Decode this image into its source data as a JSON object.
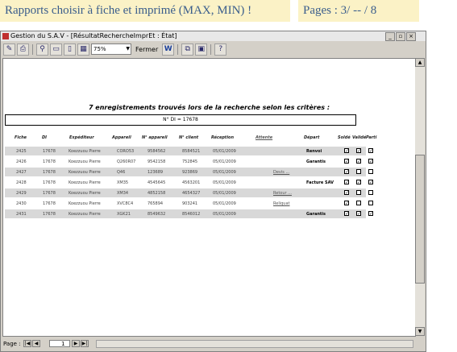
{
  "banner": {
    "title": "Rapports choisir à fiche et imprimé (MAX, MIN) !",
    "pages": "Pages : 3/ -- / 8"
  },
  "window": {
    "title": "Gestion du S.A.V - [RésultatRechercheImprEt : État]",
    "zoom": "75%",
    "close_label": "Fermer",
    "icons": [
      "view-icon",
      "print-icon",
      "zoom-icon",
      "one-page-icon",
      "two-pages-icon",
      "multiple-pages-icon",
      "word-icon",
      "database-window-icon",
      "new-object-icon",
      "help-icon"
    ]
  },
  "report": {
    "title": "7 enregistrements trouvés lors de la recherche selon les critères :",
    "criteria": "N° DI = 17678",
    "columns": [
      "Fiche",
      "DI",
      "Expéditeur",
      "Appareil",
      "N° appareil",
      "N° client",
      "Réception",
      "Attente",
      "Départ",
      "Soldé",
      "Validé",
      "Parti"
    ],
    "rows": [
      {
        "fiche": "2425",
        "di": "17678",
        "expediteur": "Koezzuou Pierre",
        "appareil": "CORO53",
        "n_appareil": "9584562",
        "n_client": "8584521",
        "reception": "05/01/2009",
        "attente": "",
        "depart": "Renvoi",
        "solde": true,
        "valide": true,
        "parti": true
      },
      {
        "fiche": "2426",
        "di": "17678",
        "expediteur": "Koezzuou Pierre",
        "appareil": "Q260R07",
        "n_appareil": "9542158",
        "n_client": "752845",
        "reception": "05/01/2009",
        "attente": "",
        "depart": "Garantis",
        "solde": true,
        "valide": true,
        "parti": true
      },
      {
        "fiche": "2427",
        "di": "17678",
        "expediteur": "Koezzuou Pierre",
        "appareil": "Q46",
        "n_appareil": "123689",
        "n_client": "923869",
        "reception": "05/01/2009",
        "attente": "Devis ...",
        "depart": "",
        "solde": true,
        "valide": false,
        "parti": false
      },
      {
        "fiche": "2428",
        "di": "17678",
        "expediteur": "Koezzuou Pierre",
        "appareil": "XM35",
        "n_appareil": "4545645",
        "n_client": "4563201",
        "reception": "05/01/2009",
        "attente": "",
        "depart": "Facture SAV",
        "solde": true,
        "valide": true,
        "parti": true
      },
      {
        "fiche": "2429",
        "di": "17678",
        "expediteur": "Koezzuou Pierre",
        "appareil": "XM34",
        "n_appareil": "4852158",
        "n_client": "4654327",
        "reception": "05/01/2009",
        "attente": "Retour ...",
        "depart": "",
        "solde": true,
        "valide": false,
        "parti": false
      },
      {
        "fiche": "2430",
        "di": "17678",
        "expediteur": "Koezzuou Pierre",
        "appareil": "XVC8C4",
        "n_appareil": "765894",
        "n_client": "903241",
        "reception": "05/01/2009",
        "attente": "Reliquat",
        "depart": "",
        "solde": true,
        "valide": false,
        "parti": false
      },
      {
        "fiche": "2431",
        "di": "17678",
        "expediteur": "Koezzuou Pierre",
        "appareil": "XGK21",
        "n_appareil": "8549632",
        "n_client": "8546012",
        "reception": "05/01/2009",
        "attente": "",
        "depart": "Garantis",
        "solde": true,
        "valide": true,
        "parti": true
      }
    ]
  },
  "status": {
    "page_label": "Page :",
    "page_value": "1"
  }
}
